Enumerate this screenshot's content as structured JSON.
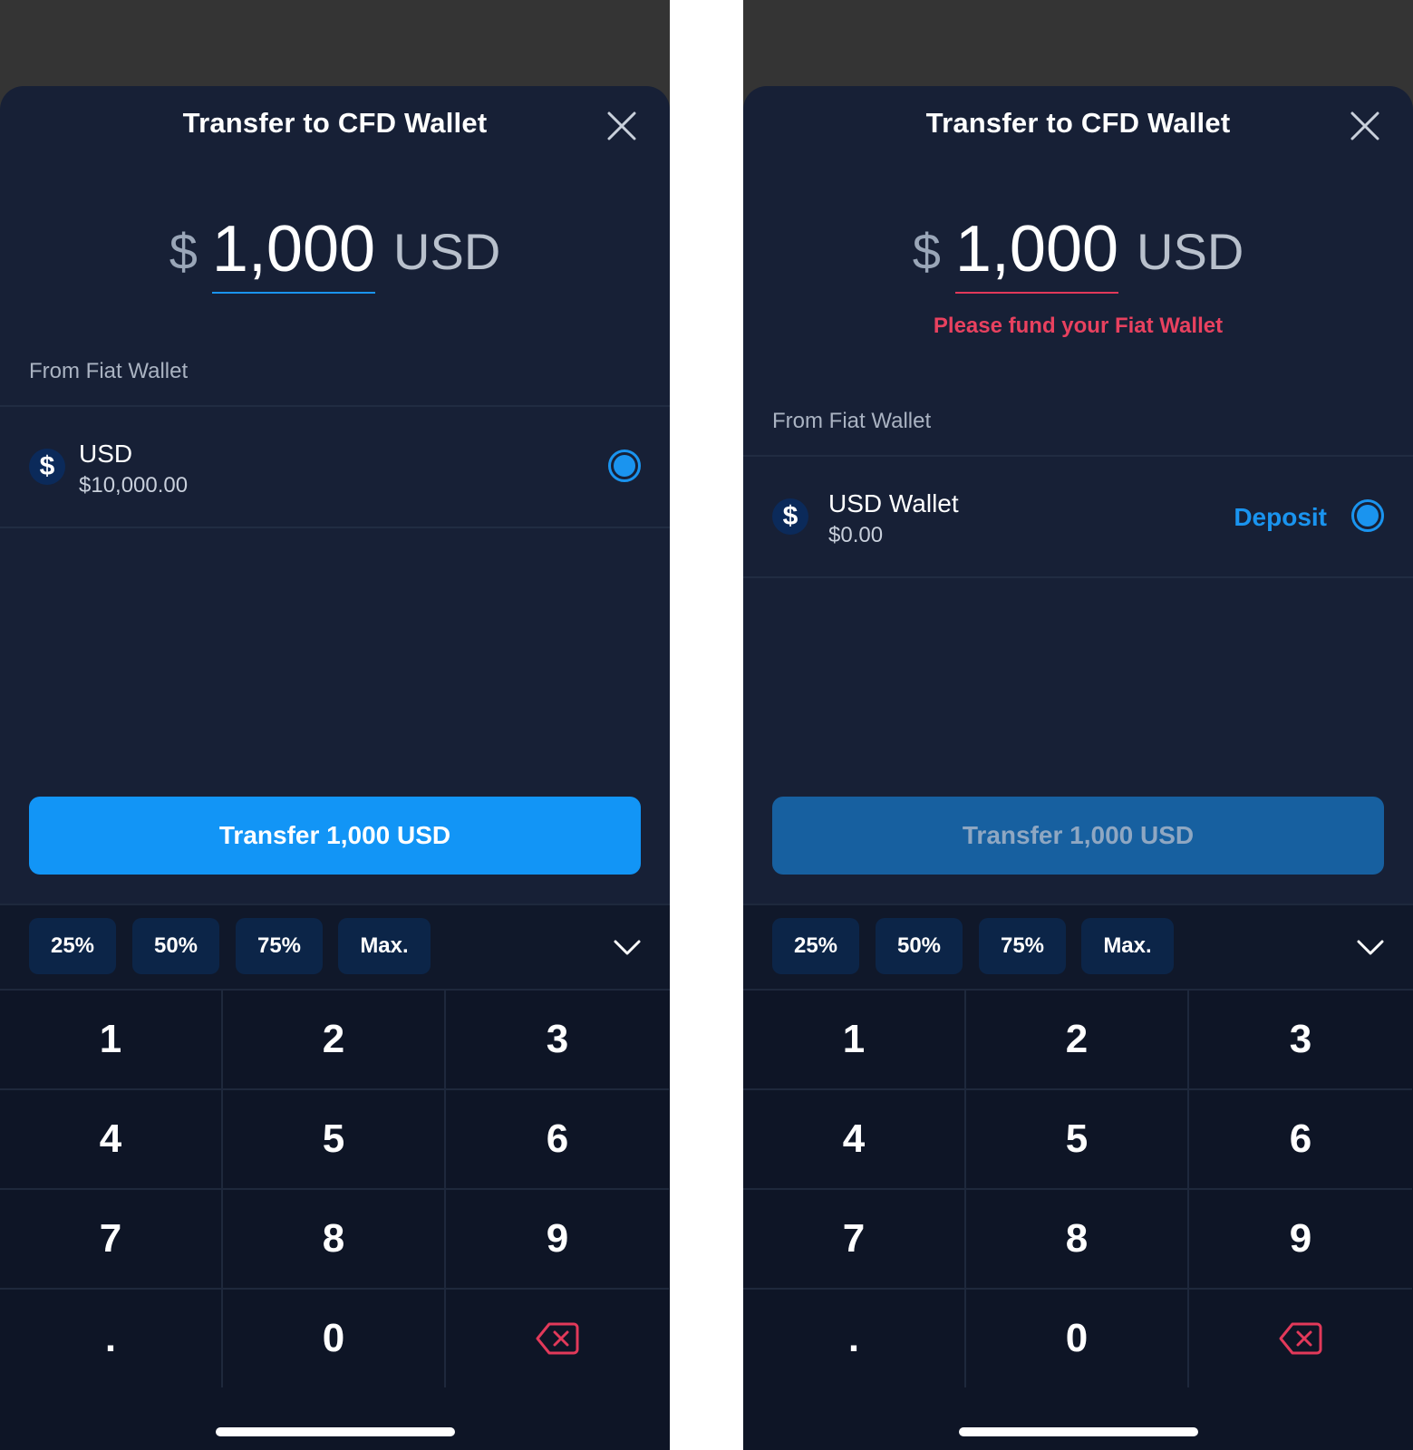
{
  "colors": {
    "accent": "#1295f6",
    "error": "#e8415f",
    "sheet_bg": "#172036",
    "keypad_bg": "#0e1526",
    "backspace": "#e2395a"
  },
  "screens": [
    {
      "title": "Transfer to CFD Wallet",
      "amount": {
        "currency_symbol": "$",
        "value": "1,000",
        "unit": "USD"
      },
      "error_text": "",
      "from_label": "From Fiat Wallet",
      "wallet": {
        "icon": "dollar-icon",
        "symbol": "$",
        "name": "USD",
        "balance": "$10,000.00",
        "deposit_label": ""
      },
      "transfer_button": {
        "label": "Transfer 1,000 USD",
        "state": "enabled"
      },
      "quick_amounts": [
        "25%",
        "50%",
        "75%",
        "Max."
      ],
      "keys": [
        "1",
        "2",
        "3",
        "4",
        "5",
        "6",
        "7",
        "8",
        "9",
        ".",
        "0"
      ]
    },
    {
      "title": "Transfer to CFD Wallet",
      "amount": {
        "currency_symbol": "$",
        "value": "1,000",
        "unit": "USD"
      },
      "error_text": "Please fund your Fiat Wallet",
      "from_label": "From Fiat Wallet",
      "wallet": {
        "icon": "dollar-icon",
        "symbol": "$",
        "name": "USD Wallet",
        "balance": "$0.00",
        "deposit_label": "Deposit"
      },
      "transfer_button": {
        "label": "Transfer 1,000 USD",
        "state": "disabled"
      },
      "quick_amounts": [
        "25%",
        "50%",
        "75%",
        "Max."
      ],
      "keys": [
        "1",
        "2",
        "3",
        "4",
        "5",
        "6",
        "7",
        "8",
        "9",
        ".",
        "0"
      ]
    }
  ]
}
